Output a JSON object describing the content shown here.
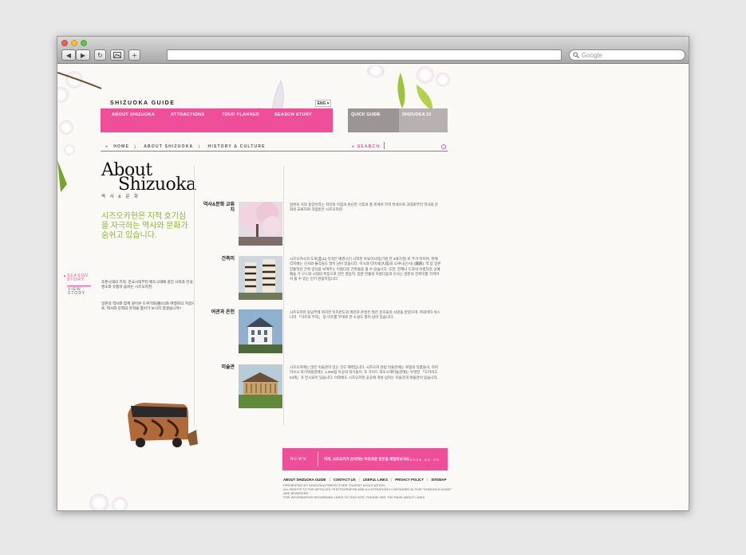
{
  "browser": {
    "search_placeholder": "Google",
    "back_glyph": "◀",
    "forward_glyph": "▶",
    "reload_glyph": "↻",
    "add_glyph": "+"
  },
  "header": {
    "brand": "SHIZUOKA GUIDE",
    "lang": "ENG ▾"
  },
  "nav": {
    "items": [
      "ABOUT SHIZUOKA",
      "ATTRACTIONS",
      "TOUR PLANNER",
      "SEASON STORY"
    ],
    "quick_guide": "QUICK GUIDE",
    "shizuoka10": "SHIZUOKA 10"
  },
  "breadcrumb": {
    "items": [
      "HOME",
      "ABOUT SHIZUOKA",
      "HISTORY & CULTURE"
    ],
    "search_label": "SEARCH"
  },
  "intro": {
    "title_line1": "About",
    "title_line2": "Shizuoka",
    "subtitle": "역 사 & 문 화",
    "lead": "시즈오카현은 지적 호기심을 자극하는 역사와 문화가 숨쉬고 있습니다.",
    "season_line1": "SEASON",
    "season_line2": "STORY",
    "view_line1": "VIEW",
    "view_line2": "STORY",
    "body1": "조몬시대의 유적, 전국시대부터 에도시대에 걸친 사적과 전설, 명소와 유품이 숨쉬는 시즈오카현.",
    "body2": "일본의 역사와 함께 걸어온 도쿠가와(德川)와 여행자의 거점으로, 역사와 문화의 흔적을 찾아가 보시지 않겠습니까?"
  },
  "sections": [
    {
      "label": "역사&문화 교류지",
      "text": "일본의 거의 중앙이라는 지리적 이점과 온난한 기후의 풍 토에서 지역 특색으로 고대로부터 역사와 문화의 교류지로 각광받은 시즈오카현."
    },
    {
      "label": "건축미",
      "text": "시즈오카시의 도로(韮山) 유적은 배경시기 시작된 야요이시대(기원 전 3세기경) 의 주거 터이며, 현재 각지에는 신사와 불각들도 많이 남아 있습니다. 이시와 타이세(大成)의 오쿠니(신사) (鐵鋼), 역 등 일본 전통적인 건축 양식을 보여주는 아름다운 건축물을 볼 수 있습니다. 또한, 언제나 도쿄의 아름다운 공예 예술 가 구스와 시대의 특징으로 만든 명승지, 일본 전통의 아름다움과 신사는 일본의 건축미를 가까이서 볼 수 있는 인기 관광지입니다."
    },
    {
      "label": "여관과 온천",
      "text": "시즈오카현 동남부에 위치한 이즈반도의 여관과 온천은 많은 문호들의 사랑을 받았으며, 카와바타 야스나리 「이즈의 무희」 등 이즈를 무대로 한 소설도 많이 남아 있습니다."
    },
    {
      "label": "미술관",
      "text": "시즈오카에는 많은 미술관이 있는 것도 매력입니다. 시즈오카 현립 미술관에는 로댕의 작품들이, 하마마쓰시 악기박물관에는 1,000점 이상의 악기들이, 또 가이드 허모시계미술관에는 유명한 「도카이도 53계」가 전시되어 있습니다. 이외에도 시즈오카현 곳곳에 개성 넘치는 미술관과 박물관이 있습니다."
    }
  ],
  "news": {
    "label": "NEWS",
    "text": "이제, 시즈오카가 선사하는 여유로운 일본을 체험해보세요!",
    "date": "2008.04.20"
  },
  "footer": {
    "links": [
      "ABOUT SHIZUOKA GUIDE",
      "CONTACT US",
      "USEFUL LINKS",
      "PRIVACY POLICY",
      "SITEMAP"
    ],
    "copy1": "PRESENTED BY SHIZUOKA PREFECTURE TOURIST ASSOCIATION.",
    "copy2": "ALL RIGHTS TO THE ARTICLES, PHOTOGRAPHS AND ILLUSTRATIONS CONTAINED IN THIS \"SHIZUOKA GUIDE\" ARE RESERVED.",
    "copy3": "FOR INFORMATION REGARDING LINKS TO THIS SITE, PLEASE SEE THE PAGE ABOUT LINKS."
  },
  "colors": {
    "accent": "#ef4f98",
    "green": "#8ab33a",
    "nav_gray": "#9c9595"
  }
}
